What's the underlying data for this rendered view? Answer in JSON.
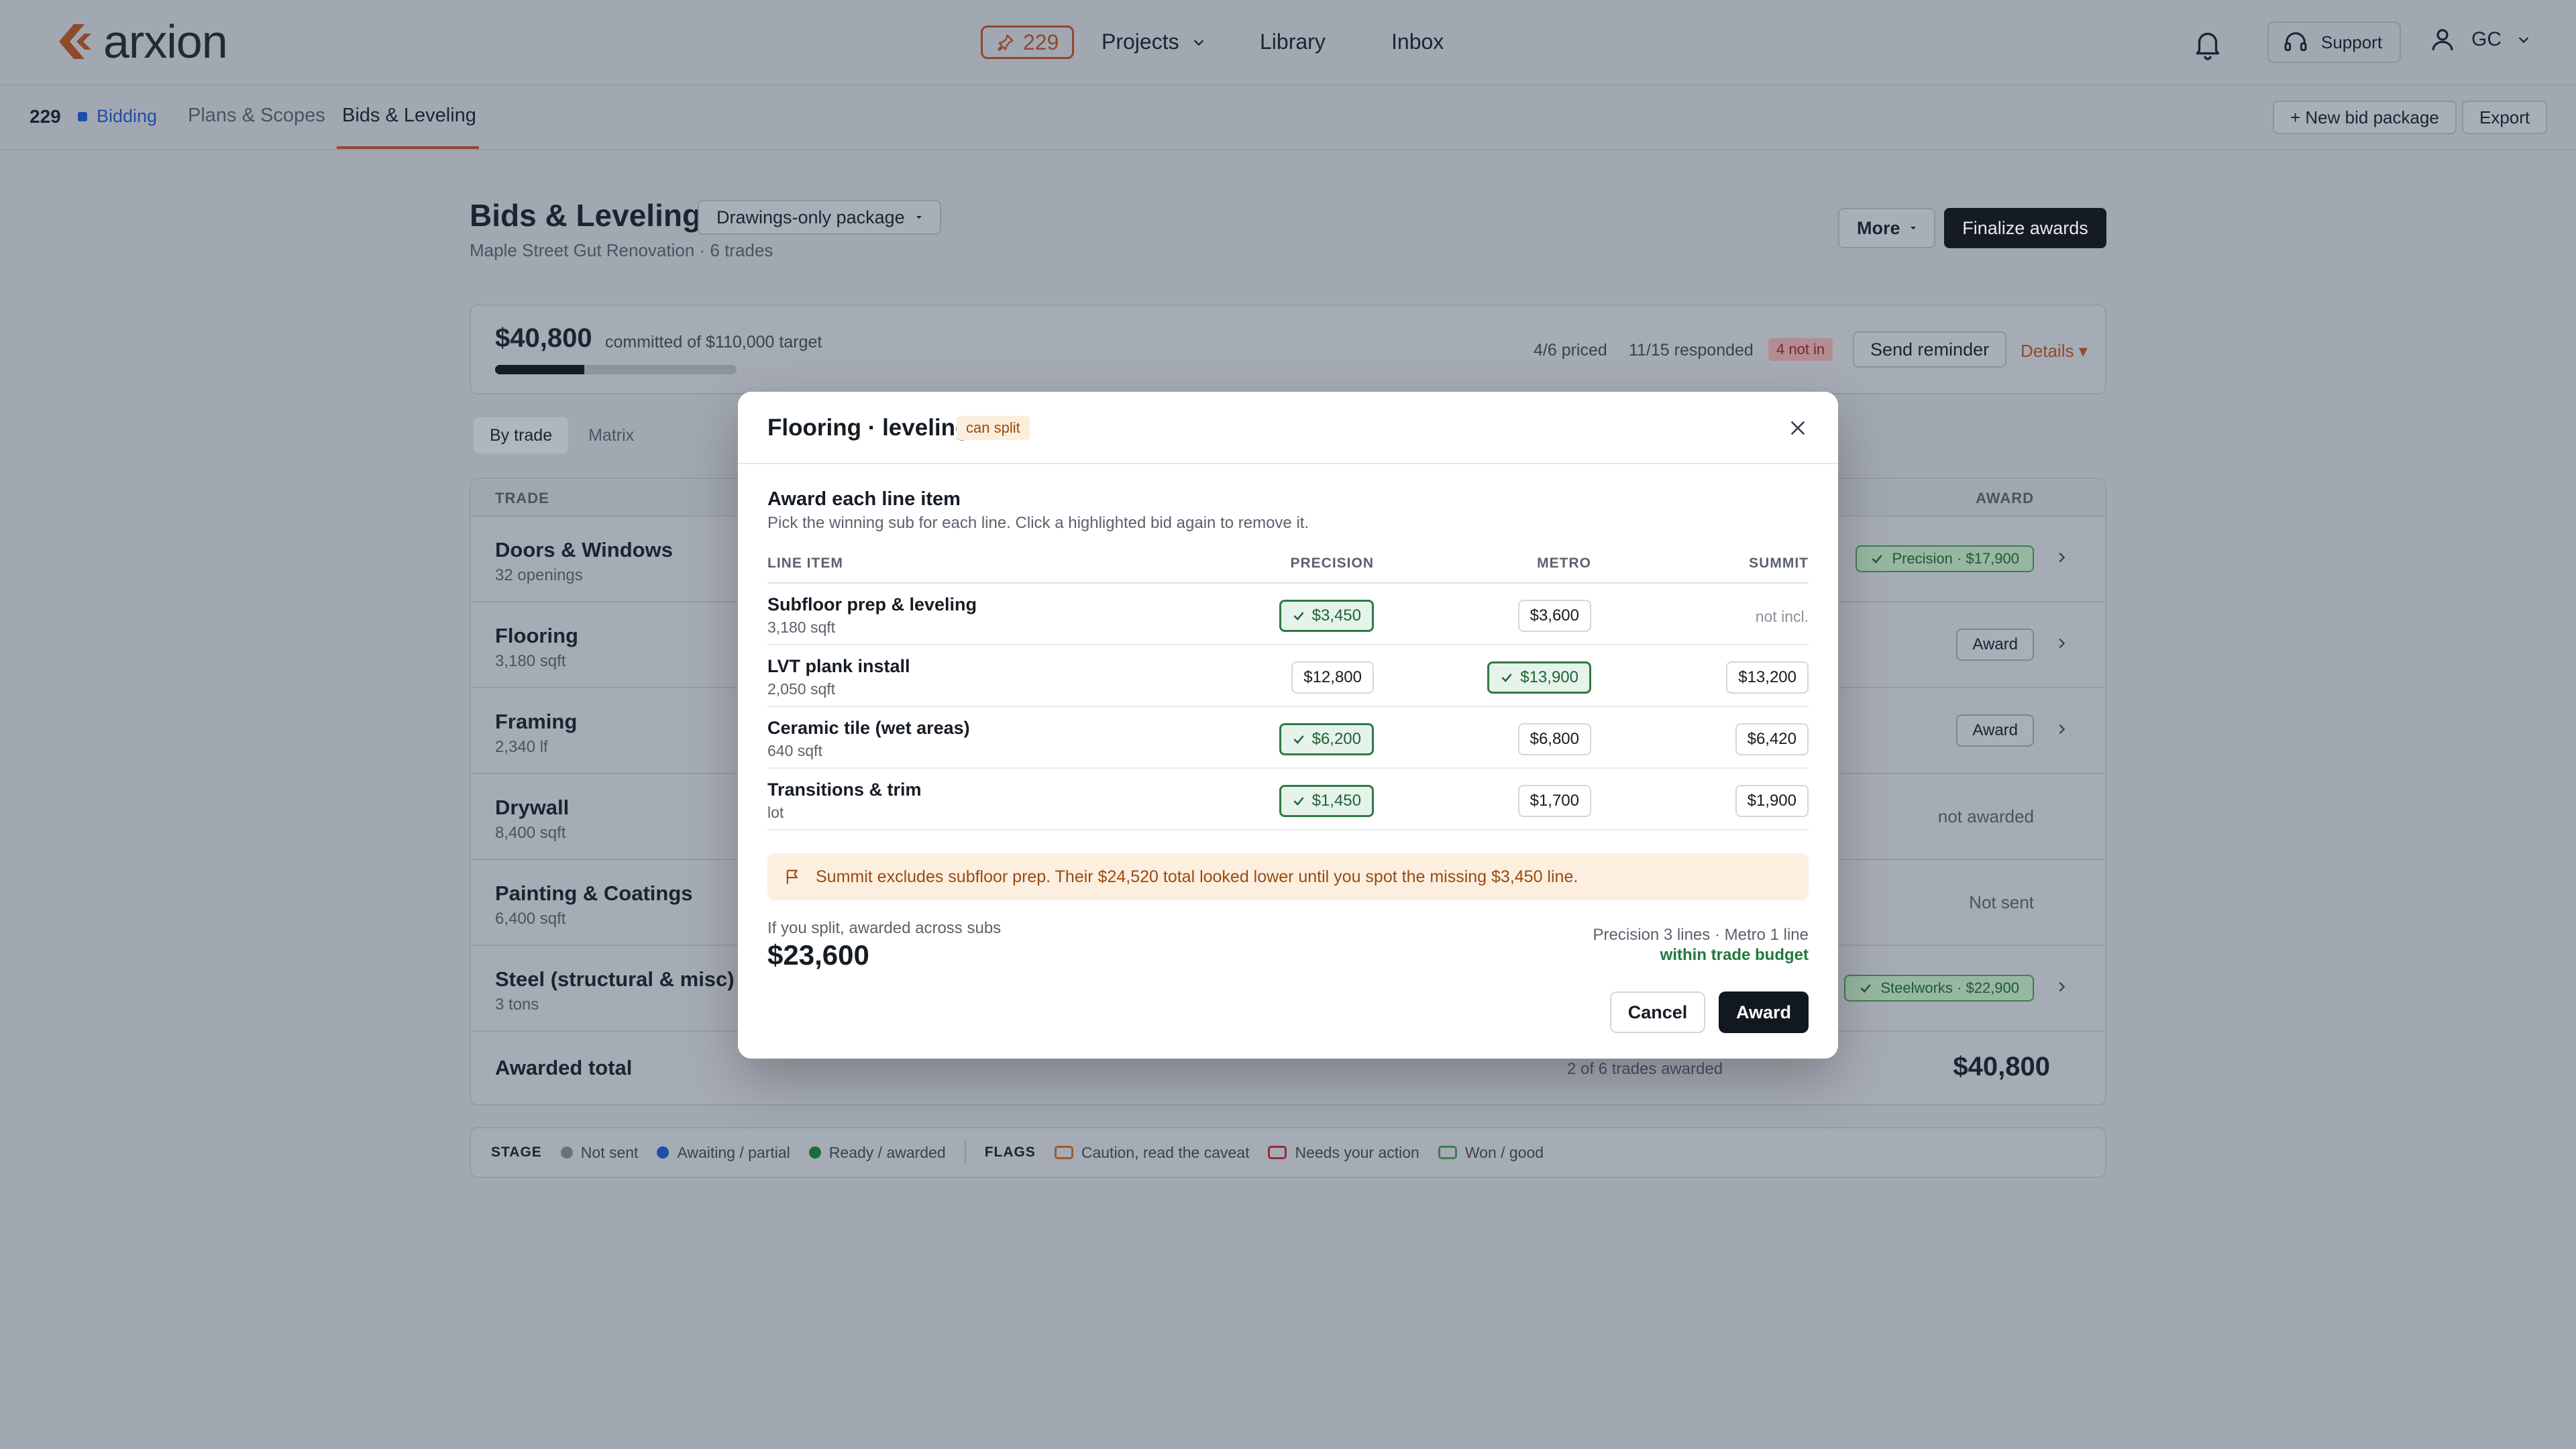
{
  "app": {
    "name": "arxion"
  },
  "header": {
    "pin_count": "229",
    "nav": {
      "projects": "Projects",
      "library": "Library",
      "inbox": "Inbox"
    },
    "support": "Support",
    "user": "GC"
  },
  "subnav": {
    "project_number": "229",
    "stage": "Bidding",
    "tabs": [
      "Plans & Scopes",
      "Bids & Leveling"
    ],
    "new_bid_package": "+ New bid package",
    "export": "Export"
  },
  "page": {
    "title": "Bids & Leveling",
    "package": "Drawings-only package",
    "subtitle": "Maple Street Gut Renovation · 6 trades",
    "more": "More",
    "finalize": "Finalize awards"
  },
  "summary": {
    "committed": "$40,800",
    "of_target": "committed of $110,000 target",
    "progress": 0.37,
    "priced": "4/6 priced",
    "responded": "11/15 responded",
    "not_in": "4 not in",
    "send_reminder": "Send reminder",
    "details": "Details"
  },
  "view_tabs": [
    "By trade",
    "Matrix"
  ],
  "trades_table": {
    "headers": {
      "trade": "TRADE",
      "award": "AWARD"
    },
    "rows": [
      {
        "name": "Doors & Windows",
        "qty": "32 openings",
        "status_type": "won",
        "status": "Precision · $17,900"
      },
      {
        "name": "Flooring",
        "qty": "3,180 sqft",
        "status_type": "award",
        "status": "Award"
      },
      {
        "name": "Framing",
        "qty": "2,340 lf",
        "status_type": "award",
        "status": "Award"
      },
      {
        "name": "Drywall",
        "qty": "8,400 sqft",
        "status_type": "text",
        "status": "not awarded"
      },
      {
        "name": "Painting & Coatings",
        "qty": "6,400 sqft",
        "status_type": "text",
        "status": "Not sent"
      },
      {
        "name": "Steel (structural & misc)",
        "qty": "3 tons",
        "status_type": "won",
        "status": "Steelworks · $22,900"
      }
    ],
    "footer": {
      "label": "Awarded total",
      "count": "2 of 6 trades awarded",
      "total": "$40,800"
    }
  },
  "legend": {
    "stage_title": "STAGE",
    "stage_items": [
      {
        "label": "Not sent",
        "color": "#6b7079"
      },
      {
        "label": "Awaiting / partial",
        "color": "#1d4ea8"
      },
      {
        "label": "Ready / awarded",
        "color": "#1f6a3a"
      }
    ],
    "flags_title": "FLAGS",
    "flag_items": [
      {
        "label": "Caution, read the caveat",
        "color": "#9a5a2c"
      },
      {
        "label": "Needs your action",
        "color": "#9a2a3a"
      },
      {
        "label": "Won / good",
        "color": "#3f7d52"
      }
    ]
  },
  "modal": {
    "title": "Flooring · leveling",
    "chip": "can split",
    "heading": "Award each line item",
    "help": "Pick the winning sub for each line. Click a highlighted bid again to remove it.",
    "columns": {
      "item": "LINE ITEM",
      "precision": "PRECISION",
      "metro": "METRO",
      "summit": "SUMMIT"
    },
    "lines": [
      {
        "name": "Subfloor prep & leveling",
        "qty": "3,180 sqft",
        "precision": "$3,450",
        "metro": "$3,600",
        "summit": "not incl.",
        "winner": "precision"
      },
      {
        "name": "LVT plank install",
        "qty": "2,050 sqft",
        "precision": "$12,800",
        "metro": "$13,900",
        "summit": "$13,200",
        "winner": "metro"
      },
      {
        "name": "Ceramic tile (wet areas)",
        "qty": "640 sqft",
        "precision": "$6,200",
        "metro": "$6,800",
        "summit": "$6,420",
        "winner": "precision"
      },
      {
        "name": "Transitions & trim",
        "qty": "lot",
        "precision": "$1,450",
        "metro": "$1,700",
        "summit": "$1,900",
        "winner": "precision"
      }
    ],
    "caveat": "Summit excludes subfloor prep. Their $24,520 total looked lower until you spot the missing $3,450 line.",
    "split_label": "If you split, awarded across subs",
    "split_value": "$23,600",
    "split_lines": "Precision 3 lines · Metro 1 line",
    "split_budget": "within trade budget",
    "cancel": "Cancel",
    "award": "Award"
  }
}
